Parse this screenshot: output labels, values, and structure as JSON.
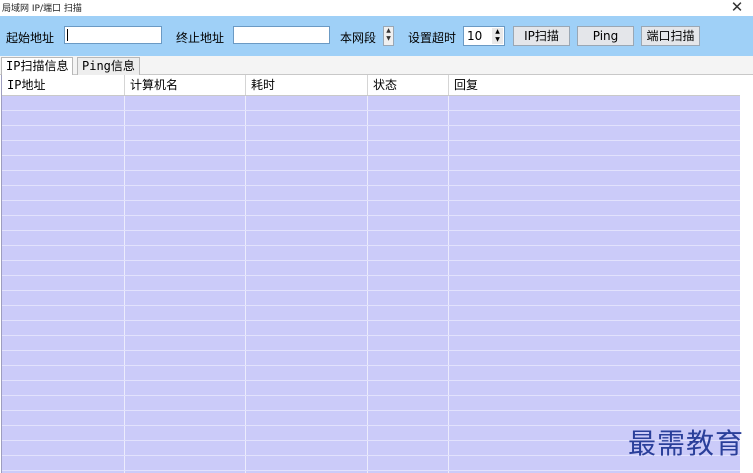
{
  "window": {
    "title": "局域网 IP/端口 扫描",
    "close_glyph": "✕"
  },
  "toolbar": {
    "start_label": "起始地址",
    "start_value": "",
    "end_label": "终止地址",
    "end_value": "",
    "segment_label": "本网段",
    "timeout_label": "设置超时",
    "timeout_value": "10",
    "ip_scan_button": "IP扫描",
    "ping_button": "Ping",
    "port_scan_button": "端口扫描"
  },
  "tabs": [
    {
      "label": "IP扫描信息",
      "active": true
    },
    {
      "label": "Ping信息",
      "active": false
    }
  ],
  "table": {
    "columns": [
      "IP地址",
      "计算机名",
      "耗时",
      "状态",
      "回复"
    ],
    "rows": []
  },
  "watermark": "最需教育",
  "colors": {
    "toolbar_bg": "#9fd0f7",
    "grid_bg": "#cbcbf9",
    "watermark": "#2a3f9a"
  }
}
